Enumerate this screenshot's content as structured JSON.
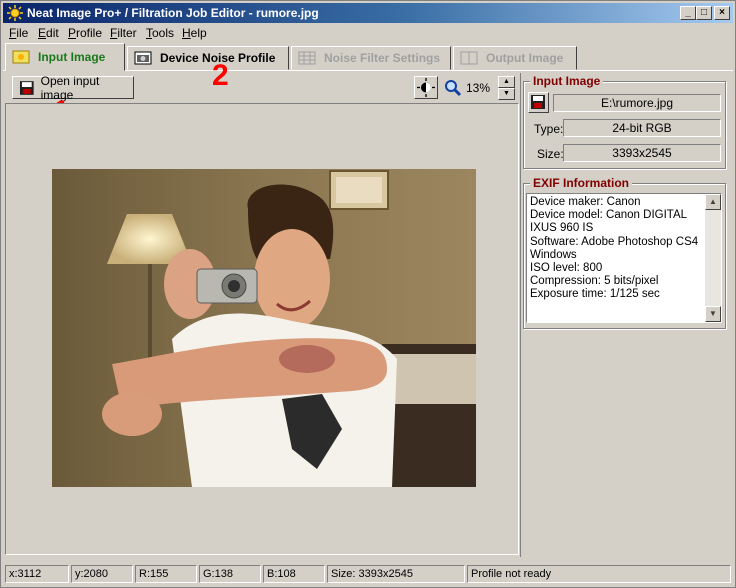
{
  "window": {
    "title": "Neat Image Pro+ / Filtration Job Editor - rumore.jpg"
  },
  "menu": [
    "File",
    "Edit",
    "Profile",
    "Filter",
    "Tools",
    "Help"
  ],
  "tabs": [
    {
      "label": "Input Image",
      "state": "active"
    },
    {
      "label": "Device Noise Profile",
      "state": "normal"
    },
    {
      "label": "Noise Filter Settings",
      "state": "disabled"
    },
    {
      "label": "Output Image",
      "state": "disabled"
    }
  ],
  "toolbar": {
    "open_label": "Open input image",
    "zoom": "13%"
  },
  "annotations": {
    "one": "1",
    "two": "2"
  },
  "input_image": {
    "title": "Input Image",
    "path": "E:\\rumore.jpg",
    "type_label": "Type:",
    "type_value": "24-bit RGB",
    "size_label": "Size:",
    "size_value": "3393x2545"
  },
  "exif": {
    "title": "EXIF Information",
    "text": "Device maker: Canon\nDevice model: Canon DIGITAL IXUS 960 IS\nSoftware: Adobe Photoshop CS4 Windows\nISO level: 800\nCompression: 5 bits/pixel\nExposure time: 1/125 sec"
  },
  "status": {
    "x": "x:3112",
    "y": "y:2080",
    "r": "R:155",
    "g": "G:138",
    "b": "B:108",
    "size": "Size: 3393x2545",
    "profile": "Profile not ready"
  },
  "colors": {
    "active_tab": "#1a7a1a",
    "group_title": "#800000",
    "annotation": "#ff0000"
  }
}
